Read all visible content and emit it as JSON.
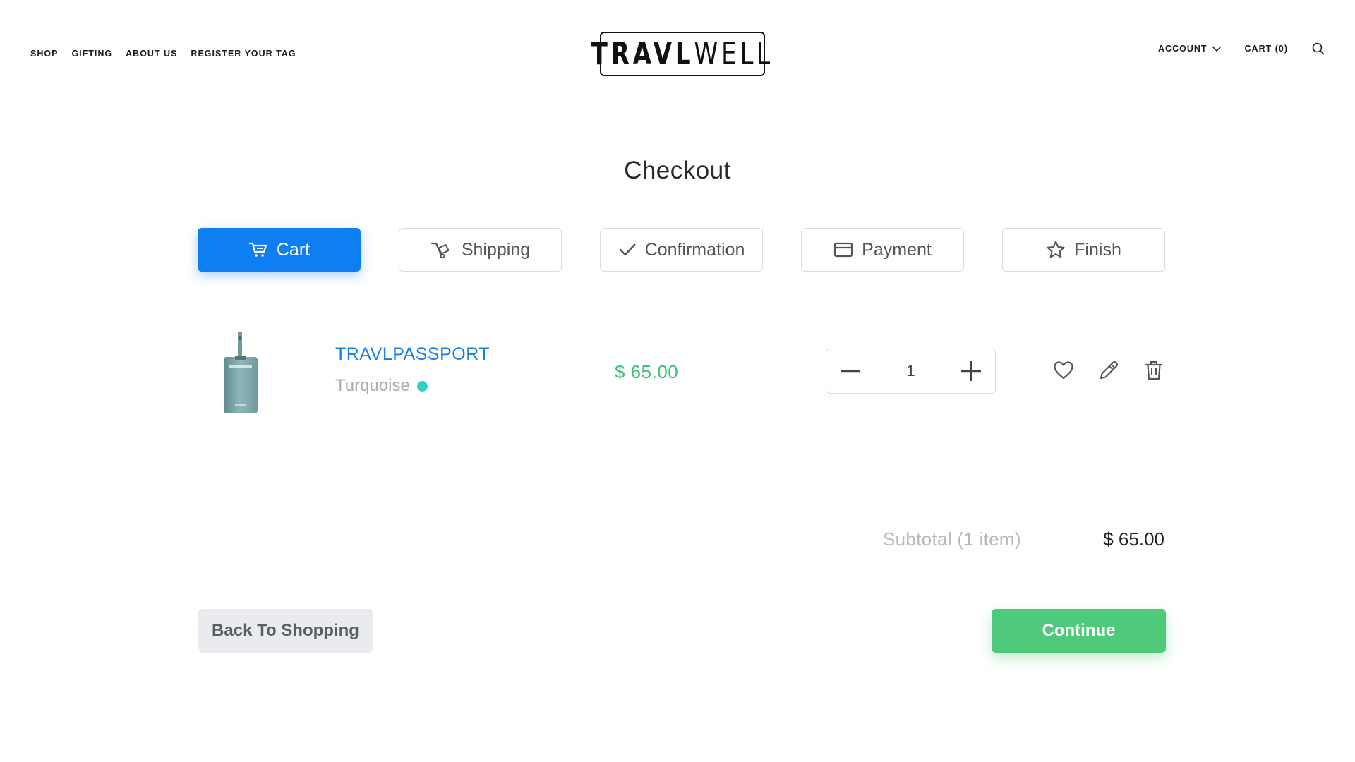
{
  "header": {
    "nav_left": [
      "SHOP",
      "GIFTING",
      "ABOUT US",
      "REGISTER YOUR TAG"
    ],
    "logo_text_bold": "TRAVL",
    "logo_text_thin": "WELL",
    "account_label": "ACCOUNT",
    "cart_label": "CART (0)"
  },
  "page": {
    "title": "Checkout"
  },
  "steps": [
    {
      "label": "Cart",
      "icon": "cart-icon",
      "active": true
    },
    {
      "label": "Shipping",
      "icon": "hand-truck-icon",
      "active": false
    },
    {
      "label": "Confirmation",
      "icon": "check-icon",
      "active": false
    },
    {
      "label": "Payment",
      "icon": "credit-card-icon",
      "active": false
    },
    {
      "label": "Finish",
      "icon": "star-icon",
      "active": false
    }
  ],
  "cart_item": {
    "name": "TRAVLPASSPORT",
    "variant": "Turquoise",
    "variant_color": "#2fd1c4",
    "price": "$ 65.00",
    "quantity": "1"
  },
  "summary": {
    "subtotal_label": "Subtotal (1 item)",
    "subtotal_value": "$ 65.00"
  },
  "buttons": {
    "back": "Back To Shopping",
    "continue": "Continue"
  },
  "colors": {
    "primary": "#0d7ff2",
    "success": "#4fc97a",
    "price": "#3ac27a",
    "link": "#1b7fe0"
  }
}
